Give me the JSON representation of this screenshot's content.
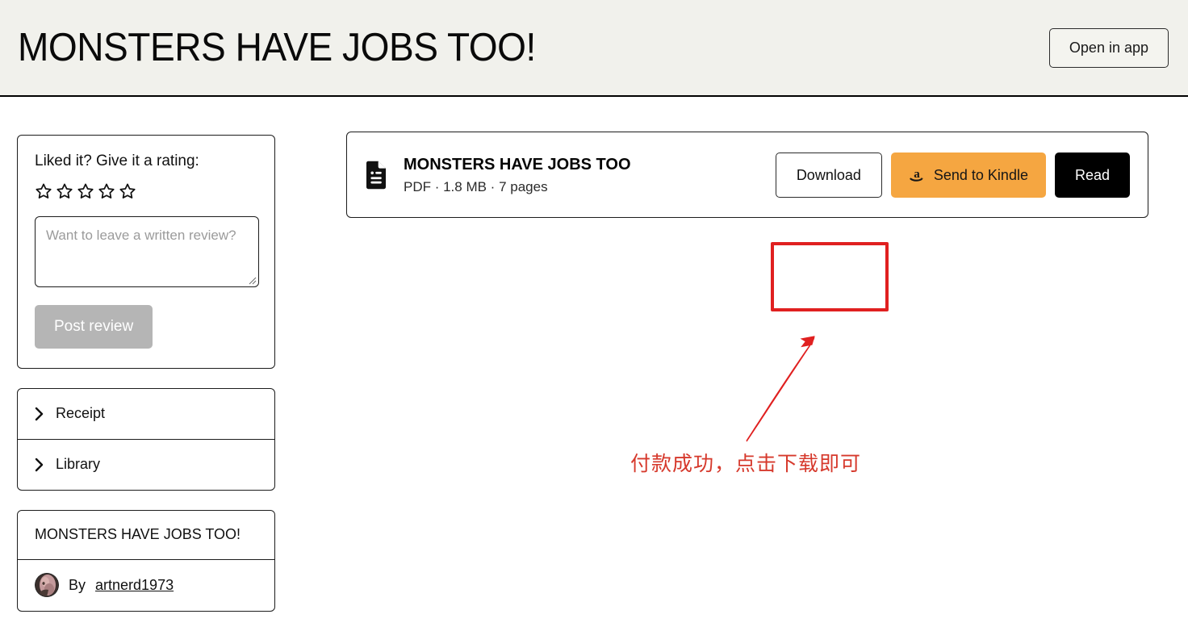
{
  "header": {
    "title": "MONSTERS HAVE JOBS TOO!",
    "open_in_app_label": "Open in app"
  },
  "sidebar": {
    "rating_card": {
      "prompt": "Liked it? Give it a rating:",
      "stars_total": 5,
      "stars_filled": 0,
      "review_placeholder": "Want to leave a written review?",
      "review_value": "",
      "post_button_label": "Post review",
      "post_button_disabled": true,
      "star_icon": "star-outline-icon",
      "resize_icon": "resize-grip-icon"
    },
    "accordion": [
      {
        "label": "Receipt",
        "icon": "chevron-right-icon",
        "expanded": false
      },
      {
        "label": "Library",
        "icon": "chevron-right-icon",
        "expanded": false
      }
    ],
    "author_card": {
      "product_title": "MONSTERS HAVE JOBS TOO!",
      "by_label": "By",
      "author_name": "artnerd1973",
      "avatar_icon": "avatar-image"
    }
  },
  "main": {
    "product": {
      "file_icon": "document-icon",
      "name": "MONSTERS HAVE JOBS TOO",
      "file_type": "PDF",
      "file_size": "1.8 MB",
      "page_count": "7 pages",
      "meta_line": "PDF · 1.8 MB · 7 pages"
    },
    "actions": [
      {
        "label": "Download",
        "style": "outline",
        "icon": null
      },
      {
        "label": "Send to Kindle",
        "style": "kindle",
        "icon": "amazon-a-icon"
      },
      {
        "label": "Read",
        "style": "dark",
        "icon": null
      }
    ]
  },
  "annotations": {
    "highlight_target": "Download",
    "highlight_color": "#e02020",
    "arrow_icon": "red-arrow-up-right-icon",
    "arrow_color": "#e02020",
    "note_text": "付款成功，点击下载即可",
    "note_color": "#d6392c"
  },
  "colors": {
    "header_background": "#f1f1ec",
    "page_background": "#ffffff",
    "border": "#1c1c1c",
    "kindle_orange": "#f5a641",
    "read_black": "#000000",
    "disabled_gray": "#b5b5b5"
  }
}
